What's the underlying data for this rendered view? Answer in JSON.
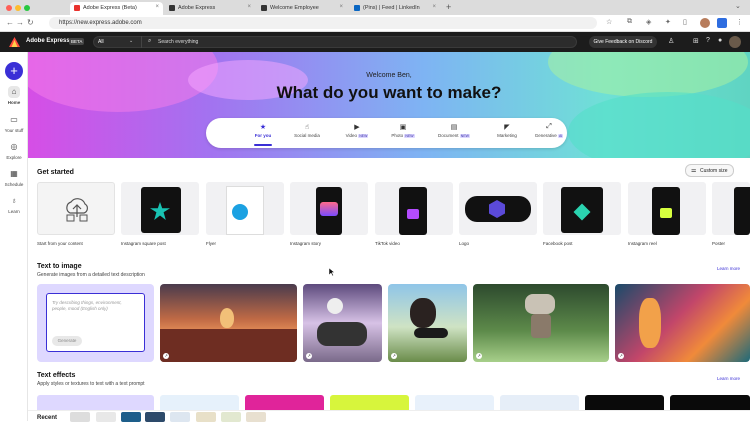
{
  "browser": {
    "tabs": [
      {
        "label": "Adobe Express (Beta)",
        "active": true
      },
      {
        "label": "Adobe Express",
        "active": false
      },
      {
        "label": "Welcome Employee",
        "active": false
      },
      {
        "label": "(Pins) | Feed | LinkedIn",
        "active": false
      }
    ],
    "url": "https://new.express.adobe.com"
  },
  "header": {
    "brand": "Adobe Express",
    "beta_badge": "BETA",
    "filter_value": "All",
    "search_placeholder": "Search everything",
    "feedback_button": "Give Feedback on Discord"
  },
  "sidebar": {
    "items": [
      {
        "label": "Home",
        "icon": "home-icon"
      },
      {
        "label": "Your stuff",
        "icon": "folder-icon"
      },
      {
        "label": "Explore",
        "icon": "compass-icon"
      },
      {
        "label": "Schedule",
        "icon": "calendar-icon"
      },
      {
        "label": "Learn",
        "icon": "lightbulb-icon"
      }
    ]
  },
  "hero": {
    "welcome": "Welcome Ben,",
    "headline": "What do you want to make?",
    "tabs": [
      {
        "label": "For you",
        "active": true,
        "badge": ""
      },
      {
        "label": "Social media",
        "active": false,
        "badge": ""
      },
      {
        "label": "Video",
        "active": false,
        "badge": "NEW"
      },
      {
        "label": "Photo",
        "active": false,
        "badge": "NEW"
      },
      {
        "label": "Document",
        "active": false,
        "badge": "NEW"
      },
      {
        "label": "Marketing",
        "active": false,
        "badge": ""
      },
      {
        "label": "Generative",
        "active": false,
        "badge": "AI"
      }
    ]
  },
  "get_started": {
    "title": "Get started",
    "custom_size": "Custom size",
    "items": [
      {
        "label": "Start from your content"
      },
      {
        "label": "Instagram square post"
      },
      {
        "label": "Flyer"
      },
      {
        "label": "Instagram story"
      },
      {
        "label": "TikTok video"
      },
      {
        "label": "Logo"
      },
      {
        "label": "Facebook post"
      },
      {
        "label": "Instagram reel"
      },
      {
        "label": "Poster"
      }
    ]
  },
  "text_to_image": {
    "title": "Text to image",
    "subtitle": "Generate images from a detailed text description",
    "learn_more": "Learn more",
    "prompt_placeholder": "Try describing things, environment, people, mood (English only)",
    "generate_button": "Generate"
  },
  "text_effects": {
    "title": "Text effects",
    "subtitle": "Apply styles or textures to text with a text prompt",
    "learn_more": "Learn more"
  },
  "recent": {
    "title": "Recent"
  },
  "colors": {
    "accent": "#3a2fd6",
    "header_bg": "#1c1c1c"
  }
}
